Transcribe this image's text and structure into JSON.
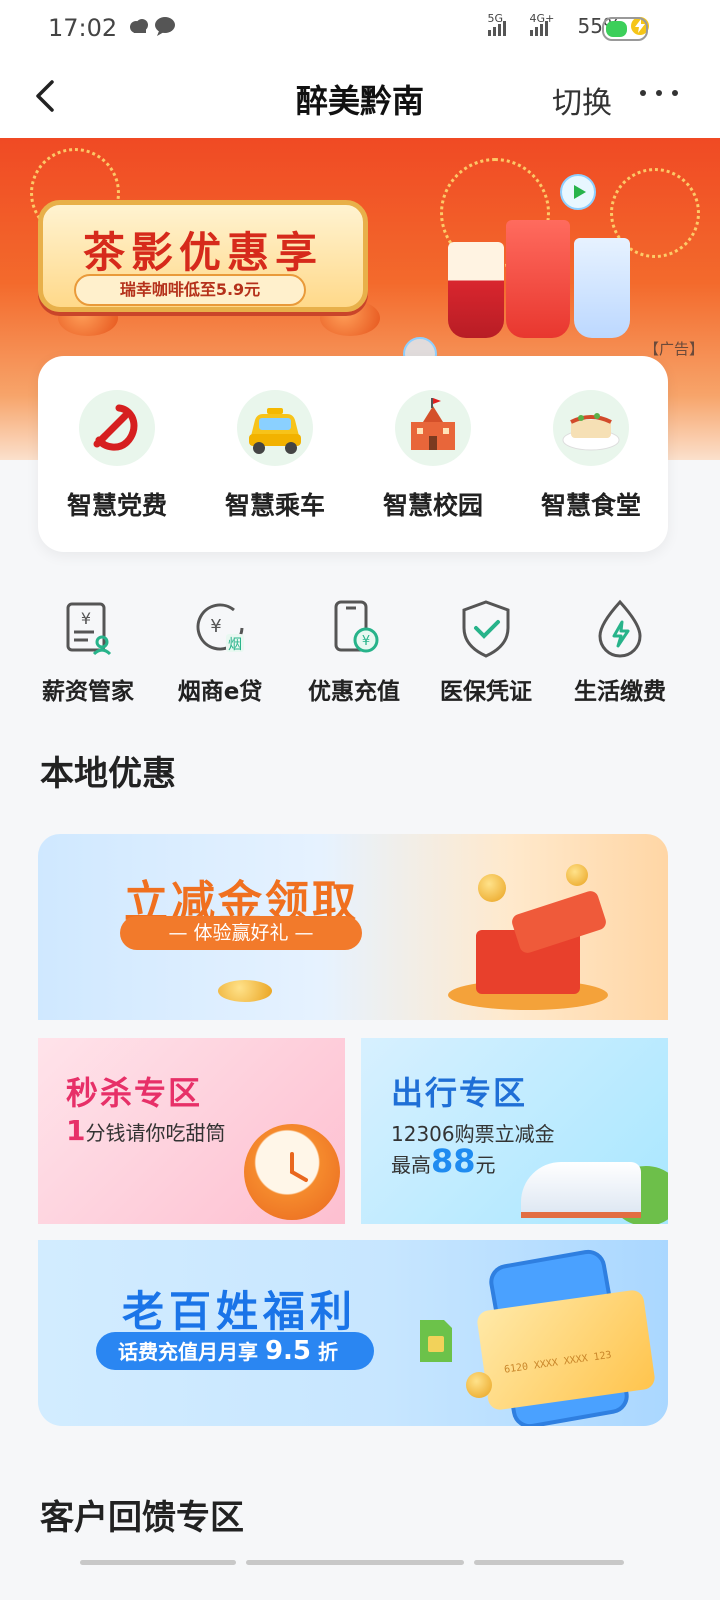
{
  "status_bar": {
    "time": "17:02",
    "signal_1_label": "5G",
    "signal_2_label": "4G+",
    "battery_percent": "55%",
    "battery_level": 0.55
  },
  "nav": {
    "title": "醉美黔南",
    "switch_label": "切换"
  },
  "banner": {
    "title": "茶影优惠享",
    "subtitle": "瑞幸咖啡低至5.9元",
    "ad_tag": "【广告】"
  },
  "services": [
    {
      "label": "智慧党费",
      "icon": "party-emblem-icon"
    },
    {
      "label": "智慧乘车",
      "icon": "taxi-icon"
    },
    {
      "label": "智慧校园",
      "icon": "school-building-icon"
    },
    {
      "label": "智慧食堂",
      "icon": "food-dish-icon"
    }
  ],
  "tools": [
    {
      "label": "薪资管家",
      "icon": "salary-document-icon"
    },
    {
      "label": "烟商e贷",
      "icon": "tobacco-loan-icon"
    },
    {
      "label": "优惠充值",
      "icon": "phone-recharge-icon"
    },
    {
      "label": "医保凭证",
      "icon": "shield-check-icon"
    },
    {
      "label": "生活缴费",
      "icon": "utility-bolt-icon"
    }
  ],
  "local_offers": {
    "section_title": "本地优惠",
    "reduce": {
      "title": "立减金领取",
      "pill": "— 体验赢好礼 —"
    },
    "seckill": {
      "title": "秒杀专区",
      "sub_num": "1",
      "sub_text": "分钱请你吃甜筒"
    },
    "travel": {
      "title": "出行专区",
      "line1": "12306购票立减金",
      "line2_prefix": "最高",
      "line2_num": "88",
      "line2_suffix": "元"
    },
    "welfare": {
      "title": "老百姓福利",
      "pill_text": "话费充值月月享",
      "pill_num": "9.5",
      "pill_suffix": "折",
      "card_number": "6120 XXXX XXXX 123"
    }
  },
  "feedback": {
    "section_title": "客户回馈专区"
  },
  "colors": {
    "brand_green": "#1fa855",
    "banner_red": "#f04a24",
    "orange": "#f0701f",
    "pink": "#e73068",
    "blue": "#1a74e8"
  }
}
